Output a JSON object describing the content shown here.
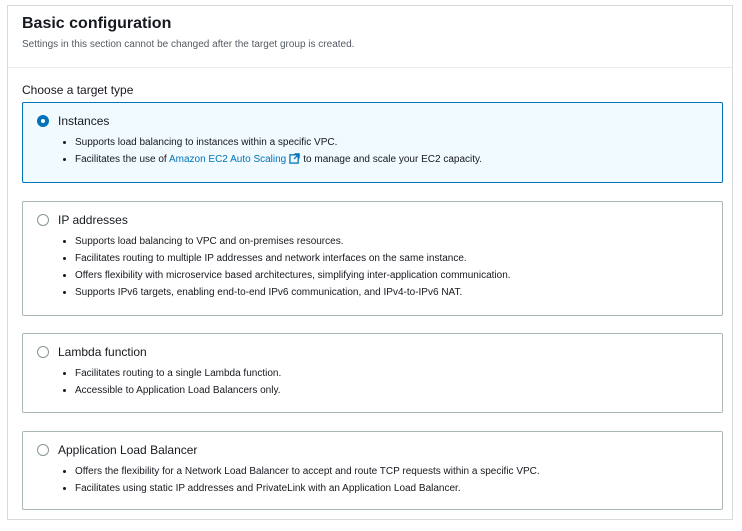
{
  "section": {
    "title": "Basic configuration",
    "subtitle": "Settings in this section cannot be changed after the target group is created."
  },
  "field_label": "Choose a target type",
  "options": [
    {
      "label": "Instances",
      "selected": true,
      "bullets": [
        "Supports load balancing to instances within a specific VPC."
      ],
      "link_bullet": {
        "before": "Facilitates the use of",
        "link": "Amazon EC2 Auto Scaling",
        "after": "to manage and scale your EC2 capacity."
      }
    },
    {
      "label": "IP addresses",
      "selected": false,
      "bullets": [
        "Supports load balancing to VPC and on-premises resources.",
        "Facilitates routing to multiple IP addresses and network interfaces on the same instance.",
        "Offers flexibility with microservice based architectures, simplifying inter-application communication.",
        "Supports IPv6 targets, enabling end-to-end IPv6 communication, and IPv4-to-IPv6 NAT."
      ]
    },
    {
      "label": "Lambda function",
      "selected": false,
      "bullets": [
        "Facilitates routing to a single Lambda function.",
        "Accessible to Application Load Balancers only."
      ]
    },
    {
      "label": "Application Load Balancer",
      "selected": false,
      "bullets": [
        "Offers the flexibility for a Network Load Balancer to accept and route TCP requests within a specific VPC.",
        "Facilitates using static IP addresses and PrivateLink with an Application Load Balancer."
      ]
    }
  ],
  "colors": {
    "accent": "#0073bb",
    "selected_background": "#f1faff",
    "border": "#aab7b8"
  },
  "icons": {
    "external_link": "external-link-icon"
  }
}
